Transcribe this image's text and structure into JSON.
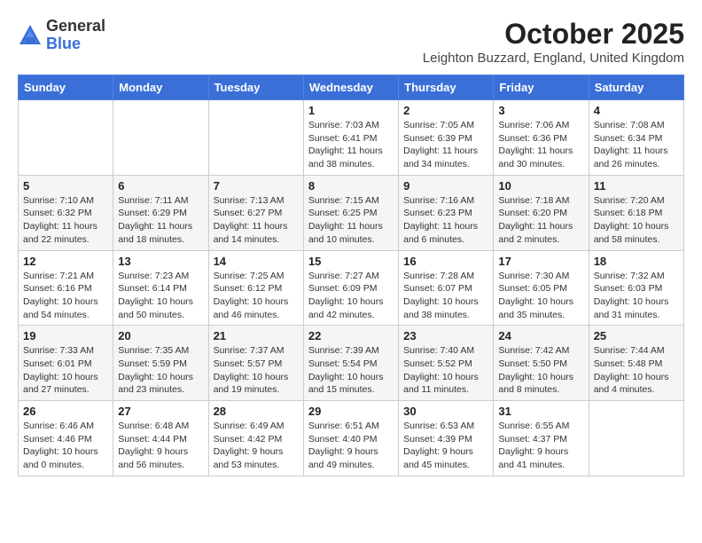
{
  "logo": {
    "general": "General",
    "blue": "Blue"
  },
  "title": "October 2025",
  "location": "Leighton Buzzard, England, United Kingdom",
  "days_of_week": [
    "Sunday",
    "Monday",
    "Tuesday",
    "Wednesday",
    "Thursday",
    "Friday",
    "Saturday"
  ],
  "weeks": [
    [
      {
        "day": "",
        "info": ""
      },
      {
        "day": "",
        "info": ""
      },
      {
        "day": "",
        "info": ""
      },
      {
        "day": "1",
        "info": "Sunrise: 7:03 AM\nSunset: 6:41 PM\nDaylight: 11 hours\nand 38 minutes."
      },
      {
        "day": "2",
        "info": "Sunrise: 7:05 AM\nSunset: 6:39 PM\nDaylight: 11 hours\nand 34 minutes."
      },
      {
        "day": "3",
        "info": "Sunrise: 7:06 AM\nSunset: 6:36 PM\nDaylight: 11 hours\nand 30 minutes."
      },
      {
        "day": "4",
        "info": "Sunrise: 7:08 AM\nSunset: 6:34 PM\nDaylight: 11 hours\nand 26 minutes."
      }
    ],
    [
      {
        "day": "5",
        "info": "Sunrise: 7:10 AM\nSunset: 6:32 PM\nDaylight: 11 hours\nand 22 minutes."
      },
      {
        "day": "6",
        "info": "Sunrise: 7:11 AM\nSunset: 6:29 PM\nDaylight: 11 hours\nand 18 minutes."
      },
      {
        "day": "7",
        "info": "Sunrise: 7:13 AM\nSunset: 6:27 PM\nDaylight: 11 hours\nand 14 minutes."
      },
      {
        "day": "8",
        "info": "Sunrise: 7:15 AM\nSunset: 6:25 PM\nDaylight: 11 hours\nand 10 minutes."
      },
      {
        "day": "9",
        "info": "Sunrise: 7:16 AM\nSunset: 6:23 PM\nDaylight: 11 hours\nand 6 minutes."
      },
      {
        "day": "10",
        "info": "Sunrise: 7:18 AM\nSunset: 6:20 PM\nDaylight: 11 hours\nand 2 minutes."
      },
      {
        "day": "11",
        "info": "Sunrise: 7:20 AM\nSunset: 6:18 PM\nDaylight: 10 hours\nand 58 minutes."
      }
    ],
    [
      {
        "day": "12",
        "info": "Sunrise: 7:21 AM\nSunset: 6:16 PM\nDaylight: 10 hours\nand 54 minutes."
      },
      {
        "day": "13",
        "info": "Sunrise: 7:23 AM\nSunset: 6:14 PM\nDaylight: 10 hours\nand 50 minutes."
      },
      {
        "day": "14",
        "info": "Sunrise: 7:25 AM\nSunset: 6:12 PM\nDaylight: 10 hours\nand 46 minutes."
      },
      {
        "day": "15",
        "info": "Sunrise: 7:27 AM\nSunset: 6:09 PM\nDaylight: 10 hours\nand 42 minutes."
      },
      {
        "day": "16",
        "info": "Sunrise: 7:28 AM\nSunset: 6:07 PM\nDaylight: 10 hours\nand 38 minutes."
      },
      {
        "day": "17",
        "info": "Sunrise: 7:30 AM\nSunset: 6:05 PM\nDaylight: 10 hours\nand 35 minutes."
      },
      {
        "day": "18",
        "info": "Sunrise: 7:32 AM\nSunset: 6:03 PM\nDaylight: 10 hours\nand 31 minutes."
      }
    ],
    [
      {
        "day": "19",
        "info": "Sunrise: 7:33 AM\nSunset: 6:01 PM\nDaylight: 10 hours\nand 27 minutes."
      },
      {
        "day": "20",
        "info": "Sunrise: 7:35 AM\nSunset: 5:59 PM\nDaylight: 10 hours\nand 23 minutes."
      },
      {
        "day": "21",
        "info": "Sunrise: 7:37 AM\nSunset: 5:57 PM\nDaylight: 10 hours\nand 19 minutes."
      },
      {
        "day": "22",
        "info": "Sunrise: 7:39 AM\nSunset: 5:54 PM\nDaylight: 10 hours\nand 15 minutes."
      },
      {
        "day": "23",
        "info": "Sunrise: 7:40 AM\nSunset: 5:52 PM\nDaylight: 10 hours\nand 11 minutes."
      },
      {
        "day": "24",
        "info": "Sunrise: 7:42 AM\nSunset: 5:50 PM\nDaylight: 10 hours\nand 8 minutes."
      },
      {
        "day": "25",
        "info": "Sunrise: 7:44 AM\nSunset: 5:48 PM\nDaylight: 10 hours\nand 4 minutes."
      }
    ],
    [
      {
        "day": "26",
        "info": "Sunrise: 6:46 AM\nSunset: 4:46 PM\nDaylight: 10 hours\nand 0 minutes."
      },
      {
        "day": "27",
        "info": "Sunrise: 6:48 AM\nSunset: 4:44 PM\nDaylight: 9 hours\nand 56 minutes."
      },
      {
        "day": "28",
        "info": "Sunrise: 6:49 AM\nSunset: 4:42 PM\nDaylight: 9 hours\nand 53 minutes."
      },
      {
        "day": "29",
        "info": "Sunrise: 6:51 AM\nSunset: 4:40 PM\nDaylight: 9 hours\nand 49 minutes."
      },
      {
        "day": "30",
        "info": "Sunrise: 6:53 AM\nSunset: 4:39 PM\nDaylight: 9 hours\nand 45 minutes."
      },
      {
        "day": "31",
        "info": "Sunrise: 6:55 AM\nSunset: 4:37 PM\nDaylight: 9 hours\nand 41 minutes."
      },
      {
        "day": "",
        "info": ""
      }
    ]
  ]
}
